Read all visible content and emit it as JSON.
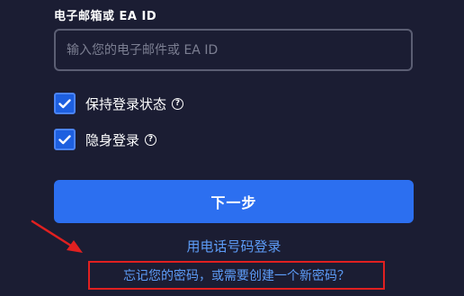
{
  "form": {
    "email_label": "电子邮箱或 EA ID",
    "email_placeholder": "输入您的电子邮件或 EA ID",
    "email_value": ""
  },
  "options": [
    {
      "label": "保持登录状态",
      "checked": true
    },
    {
      "label": "隐身登录",
      "checked": true
    }
  ],
  "help_icon_glyph": "?",
  "actions": {
    "next_label": "下一步",
    "phone_login_label": "用电话号码登录",
    "forgot_label": "忘记您的密码，或需要创建一个新密码？"
  },
  "colors": {
    "background": "#1b1d33",
    "primary": "#2c6ff0",
    "link": "#5d9cf7",
    "annotation": "#e02020"
  },
  "icons": {
    "checkbox": "checkmark-icon",
    "help": "question-circle-icon",
    "annotation": "red-arrow-icon"
  }
}
